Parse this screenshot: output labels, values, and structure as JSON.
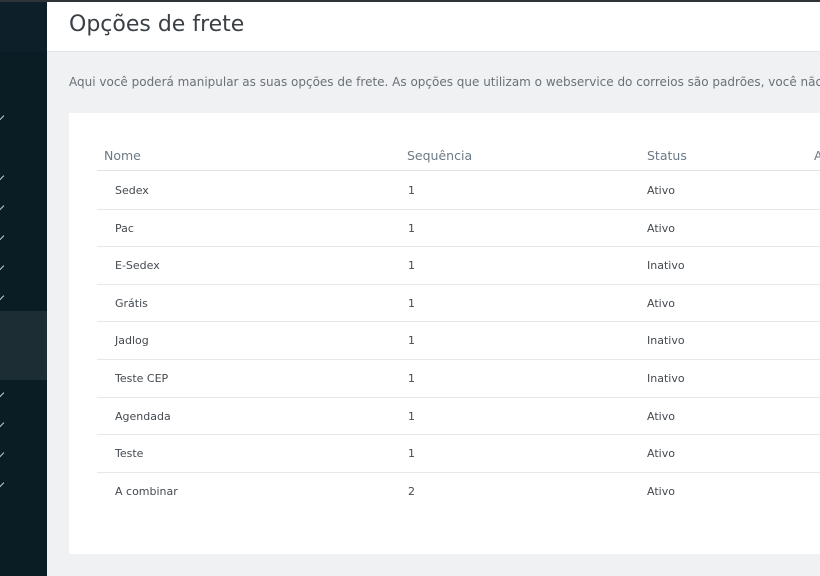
{
  "header": {
    "title": "Opções de frete"
  },
  "description": "Aqui você poderá manipular as suas opções de frete. As opções que utilizam o webservice do correios são padrões, você não pode",
  "table": {
    "columns": [
      "Nome",
      "Sequência",
      "Status",
      "A"
    ],
    "rows": [
      {
        "nome": "Sedex",
        "sequencia": "1",
        "status": "Ativo"
      },
      {
        "nome": "Pac",
        "sequencia": "1",
        "status": "Ativo"
      },
      {
        "nome": "E-Sedex",
        "sequencia": "1",
        "status": "Inativo"
      },
      {
        "nome": "Grátis",
        "sequencia": "1",
        "status": "Ativo"
      },
      {
        "nome": "Jadlog",
        "sequencia": "1",
        "status": "Inativo"
      },
      {
        "nome": "Teste CEP",
        "sequencia": "1",
        "status": "Inativo"
      },
      {
        "nome": "Agendada",
        "sequencia": "1",
        "status": "Ativo"
      },
      {
        "nome": "Teste",
        "sequencia": "1",
        "status": "Ativo"
      },
      {
        "nome": "A combinar",
        "sequencia": "2",
        "status": "Ativo"
      }
    ]
  },
  "sidebar": {
    "items": [
      {
        "icon": "chevron-down-icon"
      },
      {
        "icon": "chevron-down-icon"
      },
      {
        "icon": "chevron-down-icon"
      },
      {
        "icon": "chevron-down-icon"
      },
      {
        "icon": "chevron-down-icon"
      },
      {
        "icon": "chevron-down-icon"
      },
      {
        "icon": "chevron-down-icon"
      },
      {
        "icon": "chevron-down-icon"
      },
      {
        "icon": "chevron-down-icon"
      },
      {
        "icon": "chevron-down-icon"
      }
    ]
  },
  "colors": {
    "sidebar": "#0b1d24",
    "sidebar_active": "#1c2d34",
    "background": "#eff1f3",
    "card": "#ffffff"
  }
}
